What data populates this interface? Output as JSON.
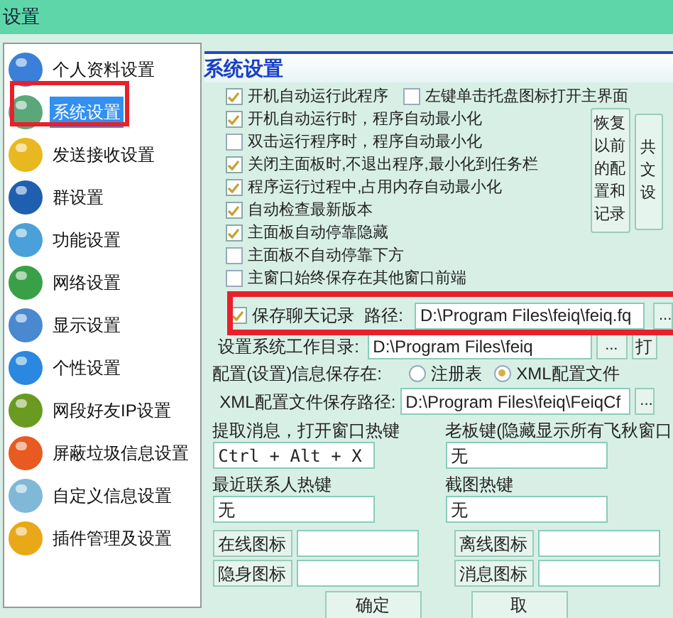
{
  "window": {
    "title": "设置"
  },
  "sidebar": {
    "items": [
      {
        "label": "个人资料设置",
        "selected": false,
        "color": "#3a7fd8"
      },
      {
        "label": "系统设置",
        "selected": true,
        "color": "#5aa87a"
      },
      {
        "label": "发送接收设置",
        "selected": false,
        "color": "#e8b820"
      },
      {
        "label": "群设置",
        "selected": false,
        "color": "#1f5fb0"
      },
      {
        "label": "功能设置",
        "selected": false,
        "color": "#4aa0d8"
      },
      {
        "label": "网络设置",
        "selected": false,
        "color": "#3aa048"
      },
      {
        "label": "显示设置",
        "selected": false,
        "color": "#4a88d0"
      },
      {
        "label": "个性设置",
        "selected": false,
        "color": "#2a88e0"
      },
      {
        "label": "网段好友IP设置",
        "selected": false,
        "color": "#6a9a20"
      },
      {
        "label": "屏蔽垃圾信息设置",
        "selected": false,
        "color": "#e85a20"
      },
      {
        "label": "自定义信息设置",
        "selected": false,
        "color": "#80b8d8"
      },
      {
        "label": "插件管理及设置",
        "selected": false,
        "color": "#e8a818"
      }
    ]
  },
  "panel": {
    "title": "系统设置",
    "option_rows": [
      [
        {
          "label": "开机自动运行此程序",
          "checked": true
        },
        {
          "label": "左键单击托盘图标打开主界面",
          "checked": false
        }
      ],
      [
        {
          "label": "开机自动运行时，程序自动最小化",
          "checked": true
        }
      ],
      [
        {
          "label": "双击运行程序时，程序自动最小化",
          "checked": false
        }
      ],
      [
        {
          "label": "关闭主面板时,不退出程序,最小化到任务栏",
          "checked": true
        }
      ],
      [
        {
          "label": "程序运行过程中,占用内存自动最小化",
          "checked": true
        }
      ],
      [
        {
          "label": "自动检查最新版本",
          "checked": true
        }
      ],
      [
        {
          "label": "主面板自动停靠隐藏",
          "checked": true
        }
      ],
      [
        {
          "label": "主面板不自动停靠下方",
          "checked": false
        }
      ],
      [
        {
          "label": "主窗口始终保存在其他窗口前端",
          "checked": false
        }
      ]
    ],
    "side_buttons": [
      {
        "kind": "full",
        "label": "恢复以前的配置和记录"
      },
      {
        "kind": "clipped",
        "label": "共文设"
      }
    ],
    "chat_log": {
      "label": "保存聊天记录",
      "checked": true,
      "path_label": "路径:",
      "path": "D:\\Program Files\\feiq\\feiq.fq",
      "button": "..."
    },
    "work_dir": {
      "label": "设置系统工作目录:",
      "value": "D:\\Program Files\\feiq",
      "button": "...",
      "open_button": "打"
    },
    "storage": {
      "label": "配置(设置)信息保存在:",
      "options": [
        {
          "label": "注册表",
          "selected": false
        },
        {
          "label": "XML配置文件",
          "selected": true
        }
      ]
    },
    "xml_path": {
      "label": "XML配置文件保存路径:",
      "value": "D:\\Program Files\\feiq\\FeiqCf",
      "button": "..."
    },
    "hotkeys": [
      {
        "label": "提取消息，打开窗口热键",
        "value": "Ctrl + Alt + X"
      },
      {
        "label": "老板键(隐藏显示所有飞秋窗口",
        "value": "无"
      },
      {
        "label": "最近联系人热键",
        "value": "无"
      },
      {
        "label": "截图热键",
        "value": "无"
      }
    ],
    "icon_buttons": [
      "在线图标",
      "离线图标",
      "隐身图标",
      "消息图标"
    ],
    "footer_buttons": [
      "确定",
      "取"
    ]
  }
}
